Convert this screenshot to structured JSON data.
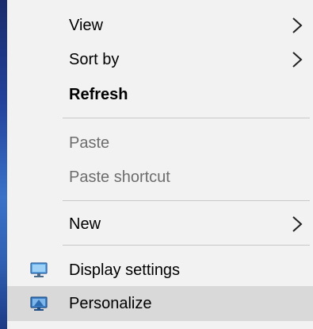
{
  "menu": {
    "items": [
      {
        "label": "View",
        "has_submenu": true,
        "enabled": true
      },
      {
        "label": "Sort by",
        "has_submenu": true,
        "enabled": true
      },
      {
        "label": "Refresh",
        "has_submenu": false,
        "enabled": true,
        "bold": true
      },
      {
        "label": "Paste",
        "has_submenu": false,
        "enabled": false
      },
      {
        "label": "Paste shortcut",
        "has_submenu": false,
        "enabled": false
      },
      {
        "label": "New",
        "has_submenu": true,
        "enabled": true
      },
      {
        "label": "Display settings",
        "icon": "display-settings-icon",
        "enabled": true
      },
      {
        "label": "Personalize",
        "icon": "personalize-icon",
        "enabled": true,
        "highlighted": true
      }
    ]
  },
  "colors": {
    "menu_background": "#f2f2f2",
    "highlight": "#d9d9d9",
    "separator": "#c8c8c8",
    "disabled_text": "#6d6d6d"
  }
}
